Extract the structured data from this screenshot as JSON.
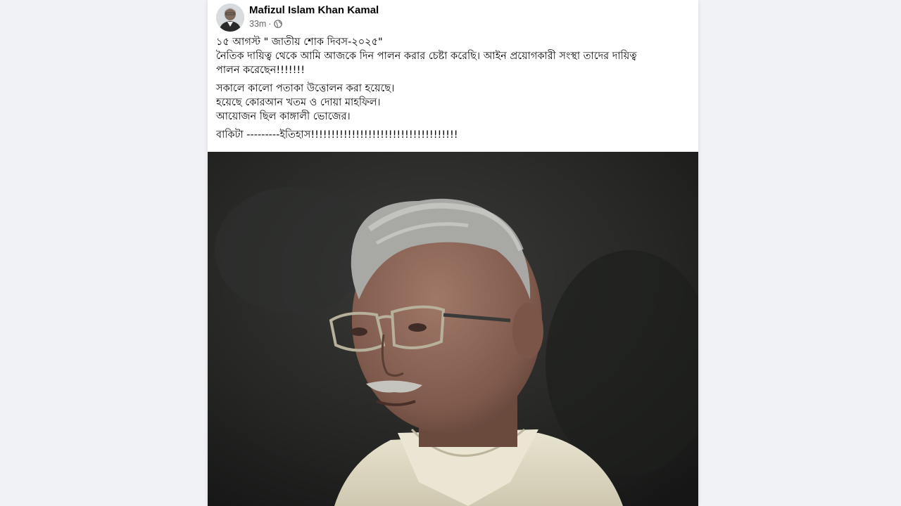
{
  "post": {
    "author_name": "Mafizul Islam Khan Kamal",
    "timestamp": "33m",
    "separator": "·",
    "privacy_icon": "globe-icon",
    "text": {
      "line1": "১৫ আগস্ট \" জাতীয় শোক দিবস-২০২৫\"",
      "line2": "নৈতিক দায়িত্ব থেকে আমি আজকে দিন পালন করার চেষ্টা করেছি। আইন প্রয়োগকারী সংস্থা  তাদের দায়িত্ব",
      "line3": "পালন করেছেন!!!!!!!",
      "line4": "সকালে কালো পতাকা উত্তোলন করা হয়েছে।",
      "line5": "হয়েছে কোরআন খতম ও দোয়া মাহফিল।",
      "line6": "আয়োজন ছিল কাঙ্গালী ভোজের।",
      "line7": "বাকিটা ---------ইতিহাস!!!!!!!!!!!!!!!!!!!!!!!!!!!!!!!!!!!!"
    }
  },
  "colors": {
    "background": "#f0f2f5",
    "card": "#ffffff",
    "primary_text": "#050505",
    "secondary_text": "#65676b"
  }
}
